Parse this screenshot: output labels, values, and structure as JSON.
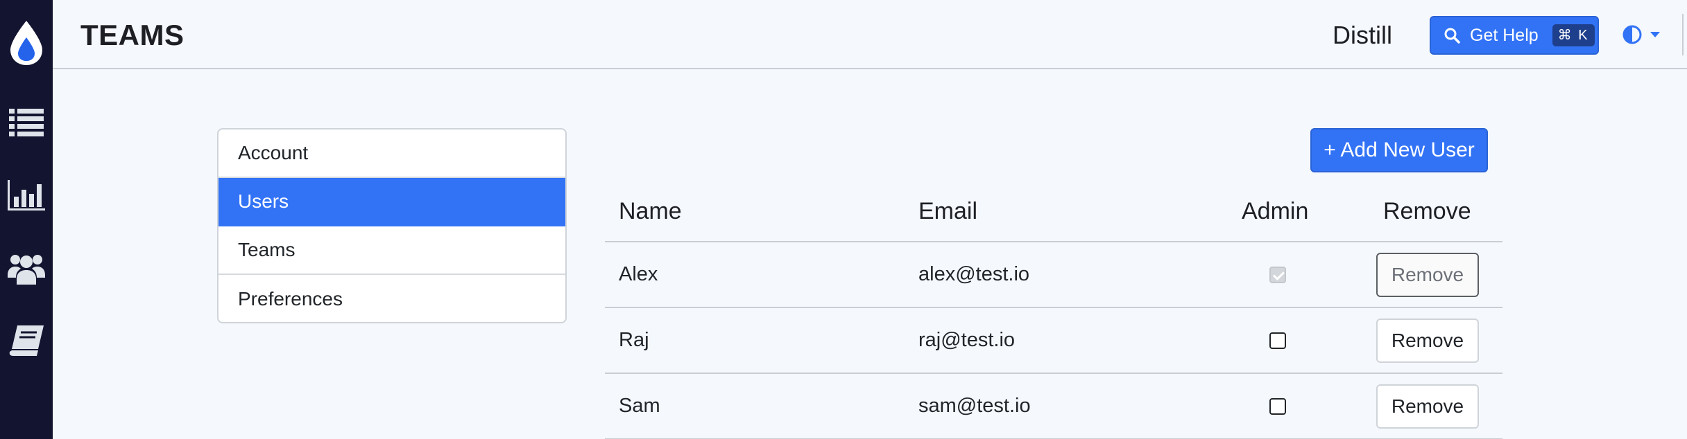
{
  "app": {
    "page_title": "TEAMS",
    "brand_name": "Distill",
    "accent_color": "#3273f6",
    "rail_color": "#121430"
  },
  "rail": {
    "items": [
      {
        "icon": "droplet-logo-icon"
      },
      {
        "icon": "list-icon"
      },
      {
        "icon": "bar-chart-icon"
      },
      {
        "icon": "users-icon"
      },
      {
        "icon": "book-icon"
      }
    ]
  },
  "header": {
    "help_label": "Get Help",
    "help_shortcut": "⌘ K",
    "theme_icon": "contrast-icon"
  },
  "settings_menu": {
    "items": [
      {
        "label": "Account",
        "active": false
      },
      {
        "label": "Users",
        "active": true
      },
      {
        "label": "Teams",
        "active": false
      },
      {
        "label": "Preferences",
        "active": false
      }
    ]
  },
  "users": {
    "add_button_label": "+ Add New User",
    "columns": {
      "name": "Name",
      "email": "Email",
      "admin": "Admin",
      "remove": "Remove"
    },
    "rows": [
      {
        "name": "Alex",
        "email": "alex@test.io",
        "admin": true,
        "admin_disabled": true,
        "remove_label": "Remove",
        "remove_disabled": true
      },
      {
        "name": "Raj",
        "email": "raj@test.io",
        "admin": false,
        "admin_disabled": false,
        "remove_label": "Remove",
        "remove_disabled": false
      },
      {
        "name": "Sam",
        "email": "sam@test.io",
        "admin": false,
        "admin_disabled": false,
        "remove_label": "Remove",
        "remove_disabled": false
      }
    ]
  }
}
